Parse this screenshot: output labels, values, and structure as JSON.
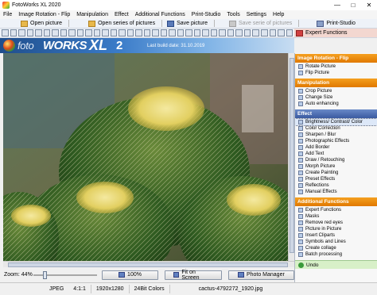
{
  "window": {
    "title": "FotoWorks XL 2020",
    "controls": [
      "—",
      "□",
      "✕"
    ]
  },
  "menu": [
    "File",
    "Image Rotation - Flip",
    "Manipulation",
    "Effect",
    "Additional Functions",
    "Print-Studio",
    "Tools",
    "Settings",
    "Help"
  ],
  "toolbar1": {
    "open_picture": "Open picture",
    "open_series": "Open series of pictures",
    "save_picture": "Save picture",
    "save_series": "Save serie of pictures",
    "print_studio": "Print-Studio",
    "expert_functions": "Expert Functions"
  },
  "toolbar2_icons": [
    "folder-icon",
    "crop-icon",
    "rotate-left-icon",
    "rotate-right-icon",
    "flip-icon",
    "zoom-icon",
    "text-icon",
    "brush-icon",
    "frame-icon",
    "sharpen-icon",
    "color-icon",
    "contrast-icon",
    "red-eye-icon",
    "magic-icon",
    "blur-icon",
    "mosaic-icon",
    "draw-icon",
    "stamp-icon",
    "mirror-icon",
    "emboss-icon",
    "resize-icon",
    "collage-icon",
    "clipart-icon",
    "mask-icon",
    "symbol-icon",
    "batch-icon",
    "light-icon",
    "cut-icon",
    "paint-icon",
    "border-icon",
    "shadow-icon",
    "undo-icon",
    "redo-icon",
    "help-icon",
    "info-icon"
  ],
  "banner": {
    "logo_part1": "foto",
    "logo_part2": "WORKS",
    "logo_part3": "XL",
    "logo_part4": "2",
    "build_date": "Last build date: 31.10.2019"
  },
  "panel": {
    "sections": [
      {
        "title": "Image Rotation - Flip",
        "style": "orange",
        "items": [
          "Rotate Picture",
          "Flip Picture"
        ]
      },
      {
        "title": "Manipulation",
        "style": "orange",
        "items": [
          "Crop Picture",
          "Change Size",
          "Auto enhancing"
        ]
      },
      {
        "title": "Effect",
        "style": "blue",
        "items": [
          "Brightness/ Contrast/ Color",
          "Color Correction",
          "Sharpen / Blur",
          "Photographic Effects",
          "Add Border",
          "Add Text",
          "Draw / Retouching",
          "Morph Picture",
          "Create Painting",
          "Preset Effects",
          "Reflections",
          "Manual Effects"
        ]
      },
      {
        "title": "Additional Functions",
        "style": "orange",
        "items": [
          "Expert Functions",
          "Masks",
          "Remove red eyes",
          "Picture in Picture",
          "Insert Cliparts",
          "Symbols and Lines",
          "Create collage",
          "Batch processing"
        ]
      }
    ],
    "selected_item": "Brightness/ Contrast/ Color",
    "undo_label": "Undo"
  },
  "zoom": {
    "label": "Zoom: 44%",
    "level_percent": 44,
    "btn_100": "100%",
    "btn_fit": "Fit on Screen",
    "btn_manager": "Photo Manager"
  },
  "status": {
    "format": "JPEG",
    "subsampling": "4:1:1",
    "dimensions": "1920x1280",
    "colors": "24Bit Colors",
    "filename": "cactus-4792272_1920.jpg"
  },
  "colors": {
    "accent_orange": "#e07800",
    "accent_blue": "#3a5aa0",
    "banner_blue": "#1f4e8c"
  }
}
